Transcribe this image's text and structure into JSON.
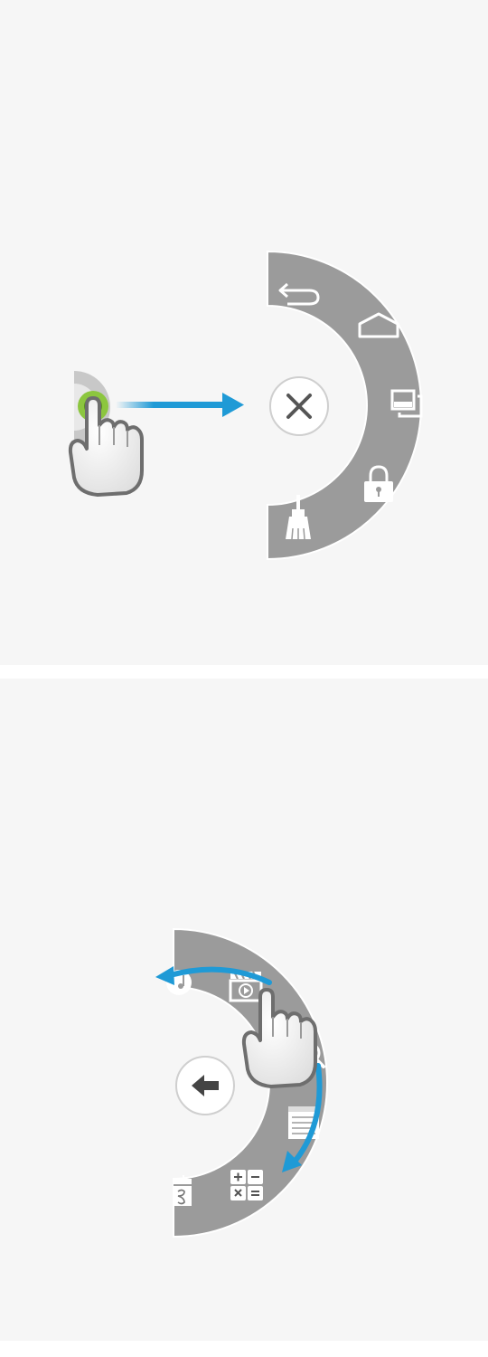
{
  "panels": [
    {
      "caption": "",
      "menu": {
        "center_button": "close-icon",
        "items": [
          "back-icon",
          "home-icon",
          "recent-apps-icon",
          "lock-icon",
          "clean-brush-icon"
        ]
      },
      "gesture": "drag-right"
    },
    {
      "caption": "",
      "menu": {
        "center_button": "back-arrow-icon",
        "items": [
          "music-icon",
          "video-icon",
          "search-icon",
          "memo-icon",
          "calculator-icon",
          "calendar-icon"
        ]
      },
      "gesture": "rotate-clockwise"
    }
  ],
  "colors": {
    "background": "#f6f6f6",
    "menu_ring": "#9b9b9b",
    "menu_ring_edge": "#ffffff",
    "accent_arrow": "#1f9ad6",
    "touch_ring": "#8cc63f",
    "icon": "#ffffff"
  }
}
